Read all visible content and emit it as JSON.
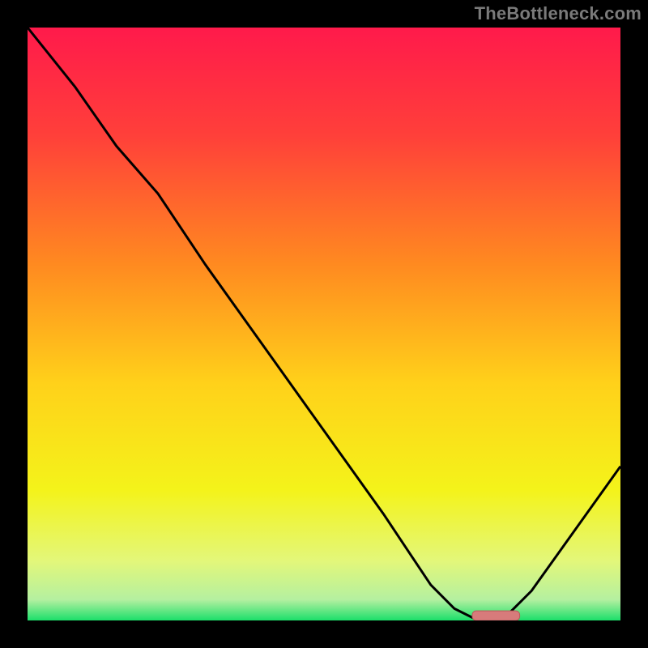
{
  "watermark": "TheBottleneck.com",
  "chart_data": {
    "type": "line",
    "title": "",
    "xlabel": "",
    "ylabel": "",
    "xlim": [
      0,
      100
    ],
    "ylim": [
      0,
      100
    ],
    "grid": false,
    "legend": false,
    "gradient_stops": [
      {
        "offset": 0.0,
        "color": "#ff1a4b"
      },
      {
        "offset": 0.18,
        "color": "#ff3f3a"
      },
      {
        "offset": 0.4,
        "color": "#ff8a20"
      },
      {
        "offset": 0.6,
        "color": "#ffd11a"
      },
      {
        "offset": 0.78,
        "color": "#f4f31a"
      },
      {
        "offset": 0.9,
        "color": "#e3f77a"
      },
      {
        "offset": 0.965,
        "color": "#b4f0a0"
      },
      {
        "offset": 1.0,
        "color": "#1bdf6a"
      }
    ],
    "series": [
      {
        "name": "bottleneck-curve",
        "x": [
          0,
          8,
          15,
          22,
          30,
          40,
          50,
          60,
          68,
          72,
          76,
          80,
          85,
          100
        ],
        "y": [
          100,
          90,
          80,
          72,
          60,
          46,
          32,
          18,
          6,
          2,
          0,
          0,
          5,
          26
        ]
      }
    ],
    "optimal_region": {
      "x_start": 75,
      "x_end": 83,
      "y": 0.8
    },
    "colors": {
      "curve": "#000000",
      "marker": "#d77b7b",
      "marker_outline": "#b95a5a"
    }
  }
}
